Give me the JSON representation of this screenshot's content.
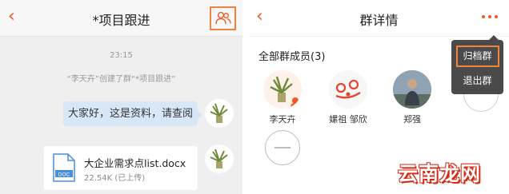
{
  "left_screen": {
    "title": "*项目跟进",
    "back_icon": "chevron-left-icon",
    "members_icon": "group-members-icon",
    "time_divider": "23:15",
    "system_message": "“李天卉”创建了群“*项目跟进”",
    "messages": [
      {
        "type": "text",
        "text": "大家好，这是资料，请查阅"
      },
      {
        "type": "file",
        "file_name": "大企业需求点list.docx",
        "file_meta": "22.54K (已上传)",
        "file_badge": "DOC"
      }
    ]
  },
  "right_screen": {
    "title": "群详情",
    "back_icon": "chevron-left-icon",
    "more_icon": "more-dots-icon",
    "section_title": "全部群成员(3)",
    "members": [
      {
        "name": "李天卉"
      },
      {
        "name": "嫘祖 邹欣"
      },
      {
        "name": "郑强"
      }
    ],
    "remove_icon": "minus-circle-icon",
    "menu": {
      "items": [
        "归档群",
        "退出群"
      ]
    }
  },
  "watermark": "云南龙网",
  "colors": {
    "accent": "#f05a28",
    "highlight": "#f0823c",
    "bubble": "#d7e7f8",
    "chat_background": "#efefef",
    "menu_background": "#4a4a4a"
  }
}
